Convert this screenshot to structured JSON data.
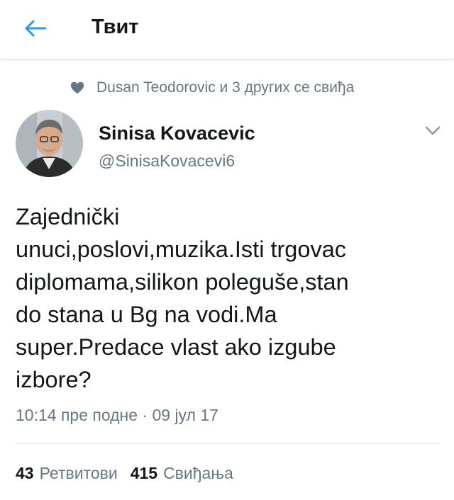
{
  "header": {
    "title": "Твит",
    "back_icon": "arrow-left-icon",
    "accent_color": "#1da1f2"
  },
  "social_context": {
    "icon": "heart-icon",
    "text": "Dusan Teodorovic и 3 других се свиђа"
  },
  "tweet": {
    "author_name": "Sinisa Kovacevic",
    "author_handle": "@SinisaKovacevi6",
    "menu_icon": "chevron-down-icon",
    "text": "Zajednički\nunuci,poslovi,muzika.Isti trgovac\ndiplomama,silikon poleguše,stan\ndo stana u Bg na vodi.Ma\nsuper.Predace vlast ako izgube\nizbore?",
    "timestamp": "10:14 пре подне · 09 јул 17"
  },
  "stats": {
    "retweets_count": "43",
    "retweets_label": "Ретвитови",
    "likes_count": "415",
    "likes_label": "Свиђања"
  },
  "colors": {
    "text_primary": "#14171a",
    "text_secondary": "#657786",
    "divider": "#e1e8ed"
  }
}
